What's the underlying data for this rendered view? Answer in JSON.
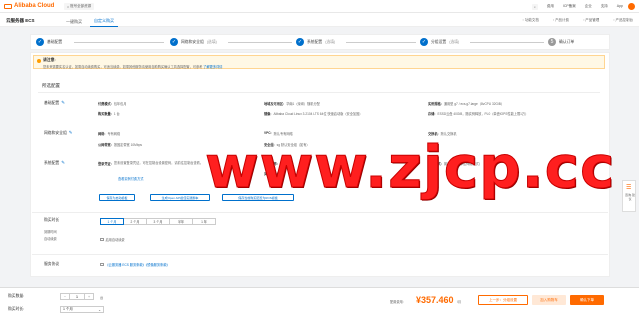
{
  "brand": {
    "logo_text": "Alibaba Cloud",
    "accent": "#ff6a00",
    "primary": "#0070cc"
  },
  "topnav": {
    "workspace": "账号全部资源",
    "links": [
      "费用",
      "ICP备案",
      "企业",
      "支持",
      "App"
    ]
  },
  "subnav": {
    "title": "云服务器 ECS",
    "tabs": [
      "一键购买",
      "自定义购买"
    ],
    "right_links": [
      "功能文档",
      "产品计费",
      "产品管理",
      "产品控制台"
    ]
  },
  "steps": [
    {
      "num": "1",
      "label": "基础配置",
      "sub": ""
    },
    {
      "num": "2",
      "label": "网络和安全组",
      "sub": "(选填)"
    },
    {
      "num": "3",
      "label": "系统配置",
      "sub": "(选填)"
    },
    {
      "num": "4",
      "label": "分组设置",
      "sub": "(选填)"
    },
    {
      "num": "5",
      "label": "确认订单",
      "sub": ""
    }
  ],
  "notice": {
    "title": "请注意:",
    "text": "您未来需要实名认证，如需自动续费购买，可适当续费。如需其他服务请使用自助购买确认工具选择配置，可参考",
    "link": "了解更多详情"
  },
  "config": {
    "section_title": "所选配置",
    "basic": {
      "label": "基础配置",
      "fields": [
        {
          "k": "付费模式:",
          "v": "包年包月"
        },
        {
          "k": "地域及可用区:",
          "v": "华南1（深圳）随机分配"
        },
        {
          "k": "实例规格:",
          "v": "通用型 g7 / ecs.g7.large（8vCPU 32GiB）"
        },
        {
          "k": "购买数量:",
          "v": "1 台"
        },
        {
          "k": "镜像:",
          "v": "Alibaba Cloud Linux 3.2104 LTS 64位 快速启动版（安全加固）"
        },
        {
          "k": "存储:",
          "v": "ESSD云盘 40GiB，随实例释放，PL0（单盘IOPS性能上限1万）"
        }
      ]
    },
    "network": {
      "label": "网络和安全组",
      "fields": [
        {
          "k": "网络:",
          "v": "专有网络"
        },
        {
          "k": "VPC:",
          "v": "默认专有网络"
        },
        {
          "k": "交换机:",
          "v": "默认交换机"
        },
        {
          "k": "公网带宽:",
          "v": "按固定带宽 10Mbps"
        },
        {
          "k": "安全组:",
          "v": "sg 默认安全组（如有）"
        }
      ]
    },
    "system": {
      "label": "系统配置",
      "fields": [
        {
          "k": "登录凭证:",
          "v": "您未设置登录凭证，可在控制台设置密码，请前往控制台查看。"
        },
        {
          "k": "实例名称:",
          "v": "",
          "extra": "默认"
        },
        {
          "k": "实例释放保护:",
          "v": ""
        },
        {
          "k": "使用方式:",
          "v": "普通模式（弹性伸缩模式）"
        }
      ],
      "link": "查看实例付费方式"
    },
    "buttons": [
      "保存为启动模板",
      "生成Open API最佳实践脚本",
      "保存当前购买配置为ROS模板"
    ]
  },
  "duration": {
    "label": "购买时长",
    "sub_labels": [
      "到期时间",
      "自动续费"
    ],
    "options": [
      "1 个月",
      "2 个月",
      "3 个月",
      "半年",
      "1 年"
    ],
    "selected": 0,
    "autorenew_label": "启用自动续费"
  },
  "agreement": {
    "label": "服务协议",
    "text": "《云服务器 ECS 服务条款》《镜像服务条款》"
  },
  "bottom": {
    "qty_label": "购买数量:",
    "qty_value": "1",
    "qty_unit": "台",
    "duration_label": "购买时长:",
    "duration_value": "1 个月",
    "price_label": "配置费用:",
    "price": "¥357.460",
    "price_unit": "/月",
    "btn_prev": "上一步：分组设置",
    "btn_cart": "加入购物车",
    "btn_order": "确认下单"
  },
  "float": {
    "text": "咨询·建议"
  },
  "watermark": "www.zjcp.cc"
}
